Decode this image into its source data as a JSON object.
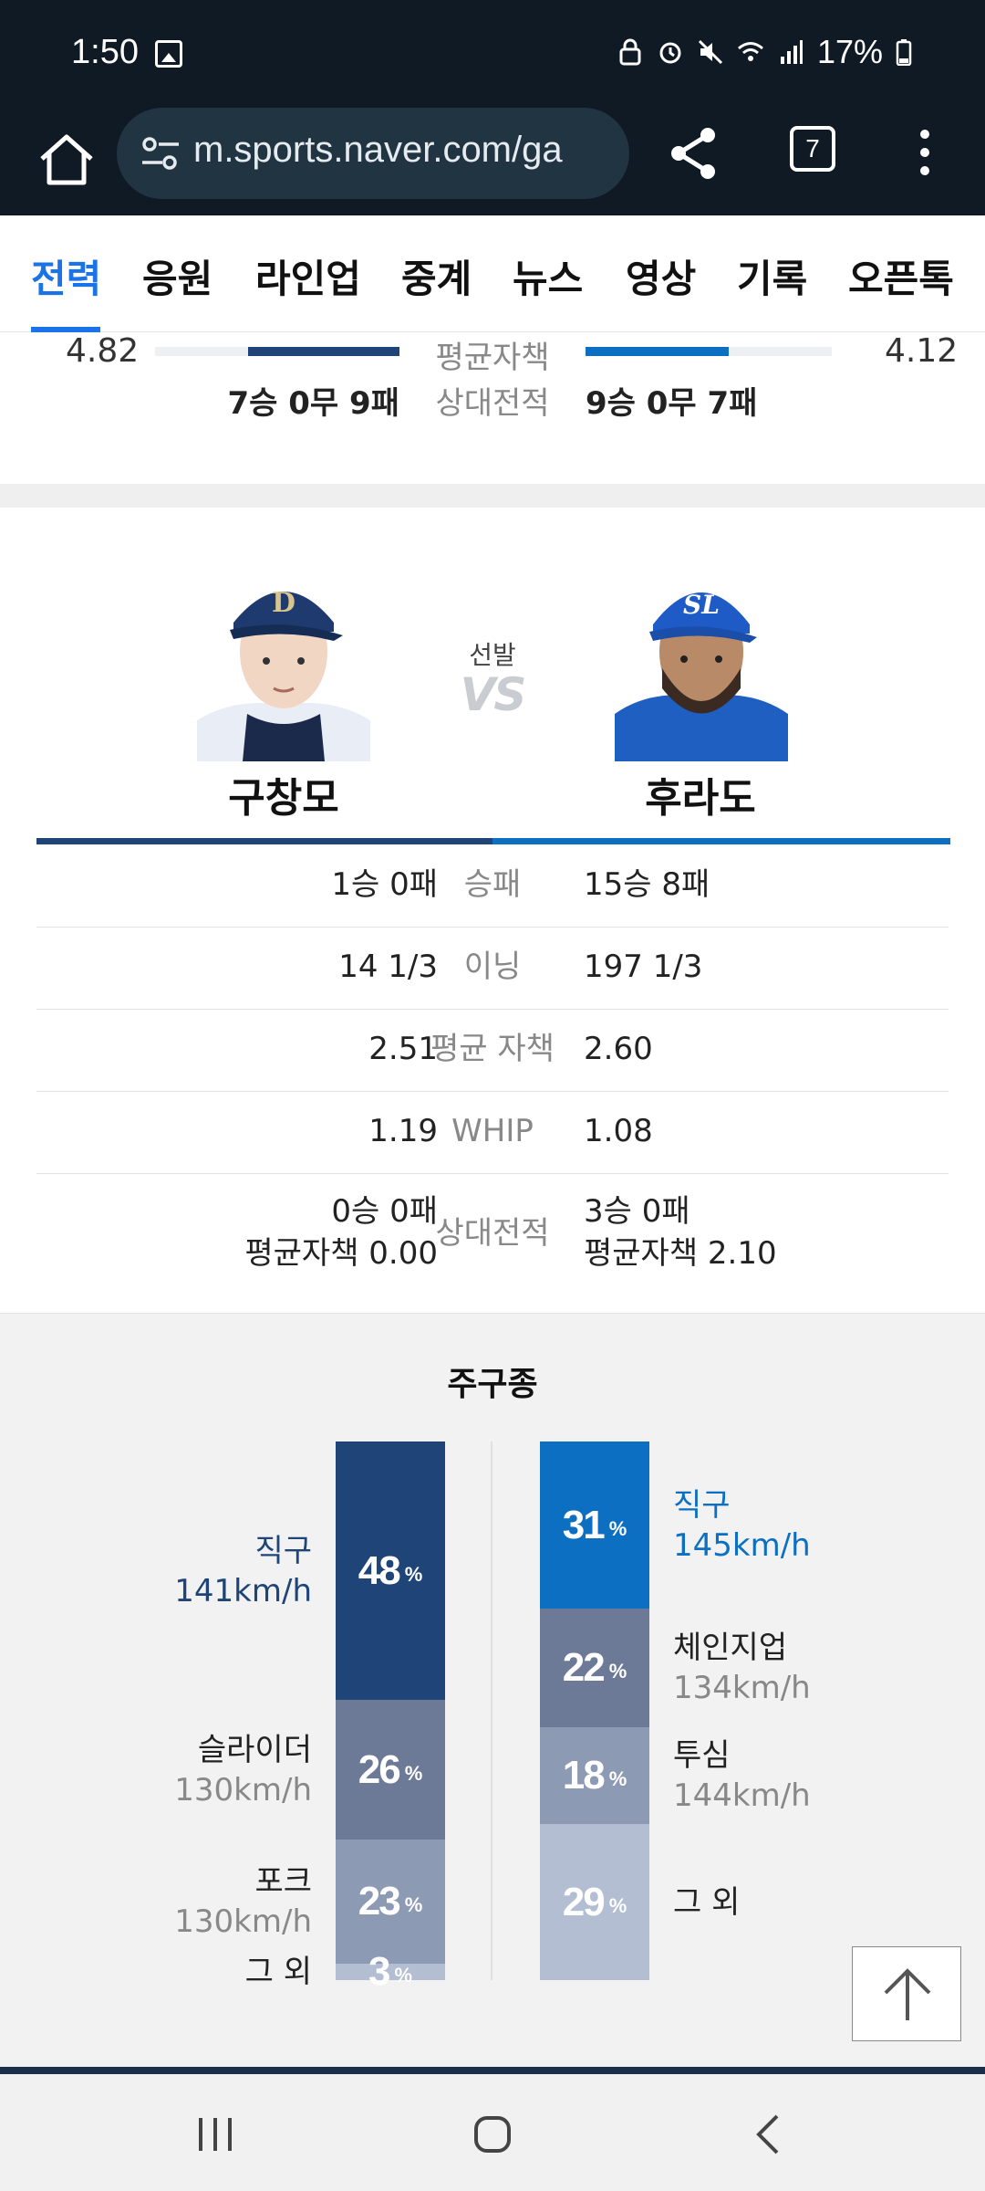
{
  "status": {
    "time": "1:50",
    "battery": "17%"
  },
  "browser": {
    "url": "m.sports.naver.com/ga",
    "tab_count": "7"
  },
  "tabs": [
    "전력",
    "응원",
    "라인업",
    "중계",
    "뉴스",
    "영상",
    "기록",
    "오픈톡"
  ],
  "summary": {
    "era_label": "평균자책",
    "era_left": "4.82",
    "era_right": "4.12",
    "era_left_fill": 0.62,
    "era_right_fill": 0.58,
    "record_label": "상대전적",
    "record_left": "7승 0무 9패",
    "record_right": "9승 0무 7패"
  },
  "starter": {
    "label": "선발",
    "vs": "VS",
    "left_name": "구창모",
    "right_name": "후라도",
    "stats": [
      {
        "left": "1승 0패",
        "label": "승패",
        "right": "15승 8패"
      },
      {
        "left": "14 1/3",
        "label": "이닝",
        "right": "197 1/3"
      },
      {
        "left": "2.51",
        "label": "평균 자책",
        "right": "2.60"
      },
      {
        "left": "1.19",
        "label": "WHIP",
        "right": "1.08"
      }
    ],
    "h2h": {
      "label": "상대전적",
      "left_line1": "0승 0패",
      "left_line2": "평균자책 0.00",
      "right_line1": "3승 0패",
      "right_line2": "평균자책 2.10"
    }
  },
  "pitches": {
    "title": "주구종",
    "left": [
      {
        "name": "직구",
        "speed": "141km/h",
        "value": "48",
        "pct": 48,
        "color": "#1f4478"
      },
      {
        "name": "슬라이더",
        "speed": "130km/h",
        "value": "26",
        "pct": 26,
        "color": "#6c7a97"
      },
      {
        "name": "포크",
        "speed": "130km/h",
        "value": "23",
        "pct": 23,
        "color": "#8d9ab4"
      },
      {
        "name": "그 외",
        "speed": "",
        "value": "3",
        "pct": 3,
        "color": "#b3bed2"
      }
    ],
    "right": [
      {
        "name": "직구",
        "speed": "145km/h",
        "value": "31",
        "pct": 31,
        "color": "#0c6fc2"
      },
      {
        "name": "체인지업",
        "speed": "134km/h",
        "value": "22",
        "pct": 22,
        "color": "#6c7a97"
      },
      {
        "name": "투심",
        "speed": "144km/h",
        "value": "18",
        "pct": 18,
        "color": "#8d9ab4"
      },
      {
        "name": "그 외",
        "speed": "",
        "value": "29",
        "pct": 29,
        "color": "#b3bed2"
      }
    ],
    "percent_sign": "%"
  }
}
